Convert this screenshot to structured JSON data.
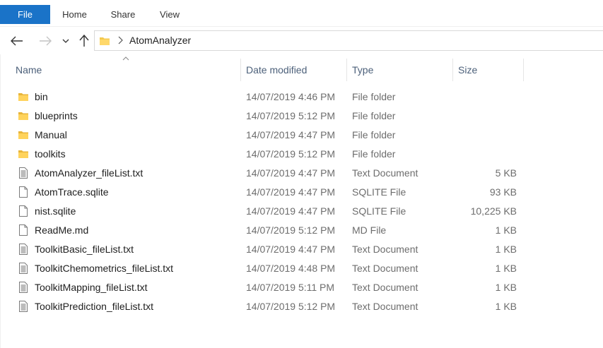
{
  "ribbon": {
    "tabs": [
      {
        "label": "File",
        "active": true
      },
      {
        "label": "Home"
      },
      {
        "label": "Share"
      },
      {
        "label": "View"
      }
    ],
    "accent_color": "#1a73c8"
  },
  "navigation": {
    "back_icon": "arrow-left-icon",
    "forward_icon": "arrow-right-icon",
    "recent_icon": "chevron-down-icon",
    "up_icon": "arrow-up-icon"
  },
  "address": {
    "folder_icon": "folder-icon",
    "path": [
      "AtomAnalyzer"
    ]
  },
  "columns": {
    "name": "Name",
    "date": "Date modified",
    "type": "Type",
    "size": "Size",
    "sorted_by": "Name"
  },
  "files": [
    {
      "name": "bin",
      "date": "14/07/2019 4:46 PM",
      "type": "File folder",
      "size": "",
      "icon": "folder-icon"
    },
    {
      "name": "blueprints",
      "date": "14/07/2019 5:12 PM",
      "type": "File folder",
      "size": "",
      "icon": "folder-icon"
    },
    {
      "name": "Manual",
      "date": "14/07/2019 4:47 PM",
      "type": "File folder",
      "size": "",
      "icon": "folder-icon"
    },
    {
      "name": "toolkits",
      "date": "14/07/2019 5:12 PM",
      "type": "File folder",
      "size": "",
      "icon": "folder-icon"
    },
    {
      "name": "AtomAnalyzer_fileList.txt",
      "date": "14/07/2019 4:47 PM",
      "type": "Text Document",
      "size": "5 KB",
      "icon": "text-file-icon"
    },
    {
      "name": "AtomTrace.sqlite",
      "date": "14/07/2019 4:47 PM",
      "type": "SQLITE File",
      "size": "93 KB",
      "icon": "blank-file-icon"
    },
    {
      "name": "nist.sqlite",
      "date": "14/07/2019 4:47 PM",
      "type": "SQLITE File",
      "size": "10,225 KB",
      "icon": "blank-file-icon"
    },
    {
      "name": "ReadMe.md",
      "date": "14/07/2019 5:12 PM",
      "type": "MD File",
      "size": "1 KB",
      "icon": "blank-file-icon"
    },
    {
      "name": "ToolkitBasic_fileList.txt",
      "date": "14/07/2019 4:47 PM",
      "type": "Text Document",
      "size": "1 KB",
      "icon": "text-file-icon"
    },
    {
      "name": "ToolkitChemometrics_fileList.txt",
      "date": "14/07/2019 4:48 PM",
      "type": "Text Document",
      "size": "1 KB",
      "icon": "text-file-icon"
    },
    {
      "name": "ToolkitMapping_fileList.txt",
      "date": "14/07/2019 5:11 PM",
      "type": "Text Document",
      "size": "1 KB",
      "icon": "text-file-icon"
    },
    {
      "name": "ToolkitPrediction_fileList.txt",
      "date": "14/07/2019 5:12 PM",
      "type": "Text Document",
      "size": "1 KB",
      "icon": "text-file-icon"
    }
  ]
}
